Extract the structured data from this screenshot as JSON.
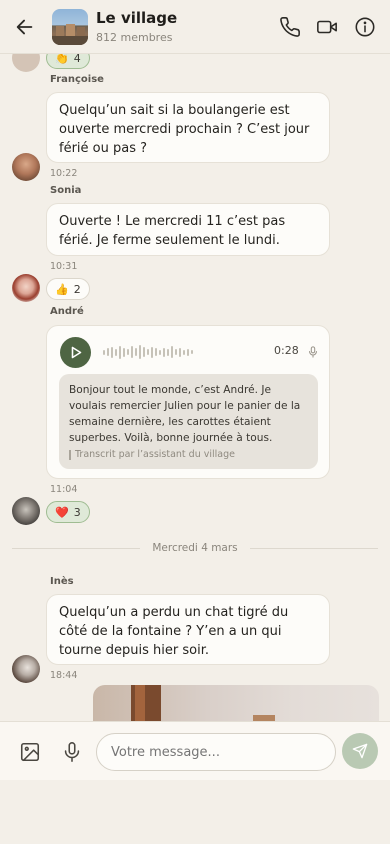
{
  "header": {
    "title": "Le village",
    "subtitle": "812 membres"
  },
  "messages": [
    {
      "reaction": {
        "emoji": "👏",
        "count": "4"
      }
    },
    {
      "sender": "Françoise",
      "text": "Quelqu’un sait si la boulangerie est ouverte mercredi prochain ? C’est jour férié ou pas ?",
      "time": "10:22"
    },
    {
      "sender": "Sonia",
      "text": "Ouverte ! Le mercredi 11 c’est pas férié. Je ferme seulement le lundi.",
      "time": "10:31",
      "reaction": {
        "emoji": "👍",
        "count": "2"
      }
    },
    {
      "sender": "André",
      "voice": {
        "duration": "0:28",
        "transcript": "Bonjour tout le monde, c’est André. Je voulais remercier Julien pour le panier de la semaine dernière, les carottes étaient superbes. Voilà, bonne journée à tous.",
        "credit": "Transcrit par l’assistant du village"
      },
      "time": "11:04",
      "reaction": {
        "emoji": "❤️",
        "count": "3"
      }
    },
    {
      "divider": "Mercredi 4 mars"
    },
    {
      "sender": "Inès",
      "text": "Quelqu’un a perdu un chat tigré du côté de la fontaine ? Y’en a un qui tourne depuis hier soir.",
      "time": "18:44"
    }
  ],
  "composer": {
    "placeholder": "Votre message..."
  },
  "colors": {
    "background": "#f3efe8",
    "accent": "#4e6543",
    "reaction_mine_bg": "#dfe9d8",
    "send_button": "#b9c9b3"
  }
}
